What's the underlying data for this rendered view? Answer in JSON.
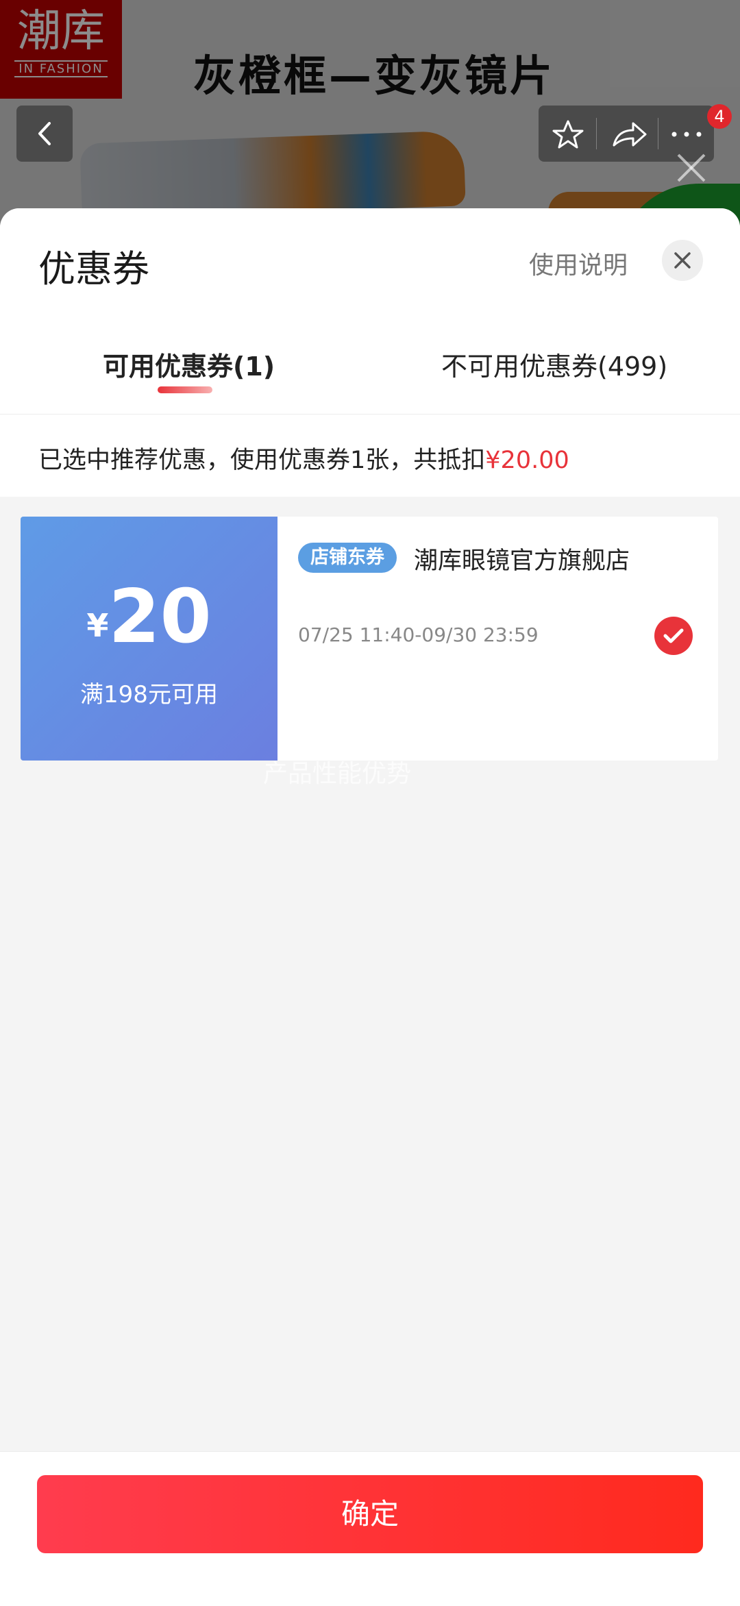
{
  "background": {
    "logo_line1": "潮库",
    "logo_line2": "IN FASHION",
    "banner_title": "灰橙框—变灰镜片",
    "cart_badge": "4",
    "icons": [
      "back-icon",
      "star-icon",
      "share-icon",
      "more-icon",
      "close-icon"
    ]
  },
  "sheet": {
    "title": "优惠券",
    "usage_link": "使用说明",
    "tabs": [
      {
        "label": "可用优惠券(1)",
        "active": true
      },
      {
        "label": "不可用优惠券(499)",
        "active": false
      }
    ],
    "summary_prefix": "已选中推荐优惠，使用优惠券1张，共抵扣",
    "summary_amount": "¥20.00"
  },
  "coupon": {
    "currency": "¥",
    "amount": "20",
    "condition": "满198元可用",
    "tag": "店铺东券",
    "shop": "潮库眼镜官方旗舰店",
    "validity": "07/25 11:40-09/30 23:59",
    "selected": true
  },
  "overlay_text": "产品性能优势",
  "footer": {
    "confirm_label": "确定"
  },
  "colors": {
    "accent_red": "#e8333a",
    "coupon_blue": "#5f9be6",
    "tag_blue": "#5b9ee2"
  }
}
